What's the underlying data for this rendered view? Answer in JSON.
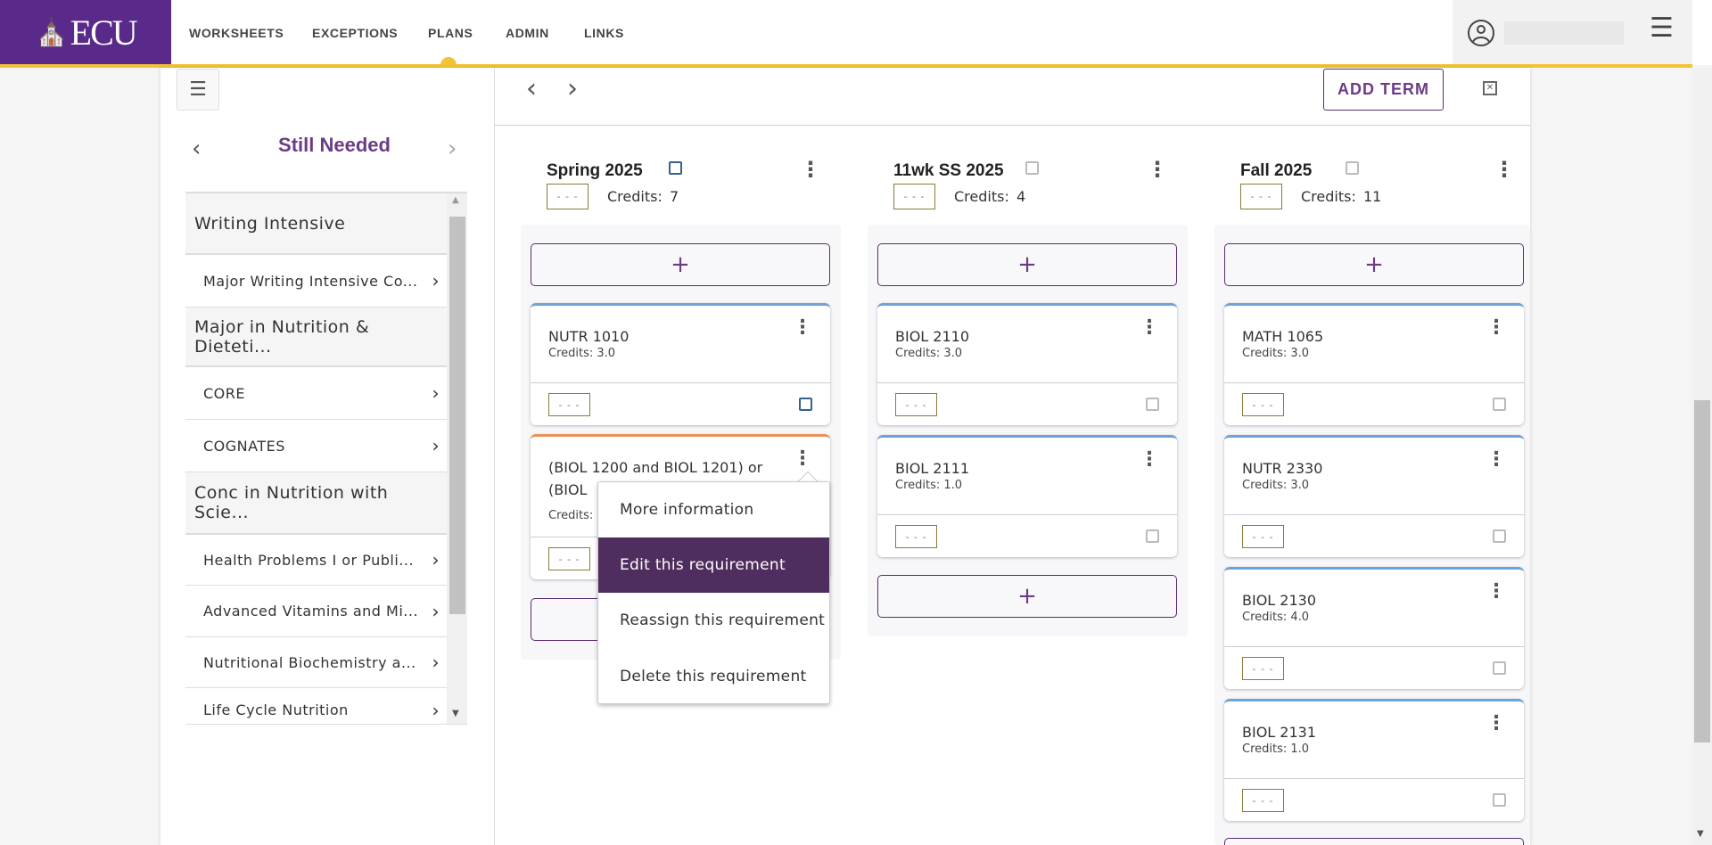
{
  "header": {
    "logo_text": "ECU",
    "nav": [
      "WORKSHEETS",
      "EXCEPTIONS",
      "PLANS",
      "ADMIN",
      "LINKS"
    ],
    "active_nav": "PLANS"
  },
  "colors": {
    "brand_purple": "#592a8a",
    "accent_gold": "#f2c335",
    "menu_highlight": "#4f2d5e",
    "card_blue": "#6fa3d6",
    "card_orange": "#e8935a"
  },
  "sidebar": {
    "title": "Still Needed",
    "rows": [
      {
        "type": "section",
        "label": "Writing Intensive"
      },
      {
        "type": "item",
        "label": "Major Writing Intensive Co..."
      },
      {
        "type": "section",
        "label": "Major in Nutrition & Dieteti..."
      },
      {
        "type": "item",
        "label": "CORE"
      },
      {
        "type": "item",
        "label": "COGNATES"
      },
      {
        "type": "section",
        "label": "Conc in Nutrition with Scie..."
      },
      {
        "type": "item",
        "label": "Health Problems I or Publi..."
      },
      {
        "type": "item",
        "label": "Advanced Vitamins and Mi..."
      },
      {
        "type": "item",
        "label": "Nutritional Biochemistry a..."
      },
      {
        "type": "item",
        "label": "Life Cycle Nutrition"
      }
    ]
  },
  "toolbar": {
    "add_term": "ADD TERM"
  },
  "badge_text": "- - -",
  "plus": "+",
  "terms": [
    {
      "title": "Spring 2025",
      "credits_label": "Credits:",
      "credits": "7",
      "note_active": true,
      "courses": [
        {
          "title": "NUTR 1010",
          "credits": "Credits: 3.0",
          "color": "blue",
          "note_active": true
        },
        {
          "title": "(BIOL 1200 and BIOL 1201) or (BIOL",
          "credits": "Credits:",
          "color": "orange"
        }
      ]
    },
    {
      "title": "11wk SS 2025",
      "credits_label": "Credits:",
      "credits": "4",
      "courses": [
        {
          "title": "BIOL 2110",
          "credits": "Credits: 3.0",
          "color": "blue"
        },
        {
          "title": "BIOL 2111",
          "credits": "Credits: 1.0",
          "color": "blue"
        }
      ]
    },
    {
      "title": "Fall 2025",
      "credits_label": "Credits:",
      "credits": "11",
      "courses": [
        {
          "title": "MATH 1065",
          "credits": "Credits: 3.0",
          "color": "blue"
        },
        {
          "title": "NUTR 2330",
          "credits": "Credits: 3.0",
          "color": "blue"
        },
        {
          "title": "BIOL 2130",
          "credits": "Credits: 4.0",
          "color": "blue"
        },
        {
          "title": "BIOL 2131",
          "credits": "Credits: 1.0",
          "color": "blue"
        }
      ]
    }
  ],
  "context_menu": {
    "items": [
      "More information",
      "Edit this requirement",
      "Reassign this requirement",
      "Delete this requirement"
    ],
    "highlighted": "Edit this requirement"
  }
}
